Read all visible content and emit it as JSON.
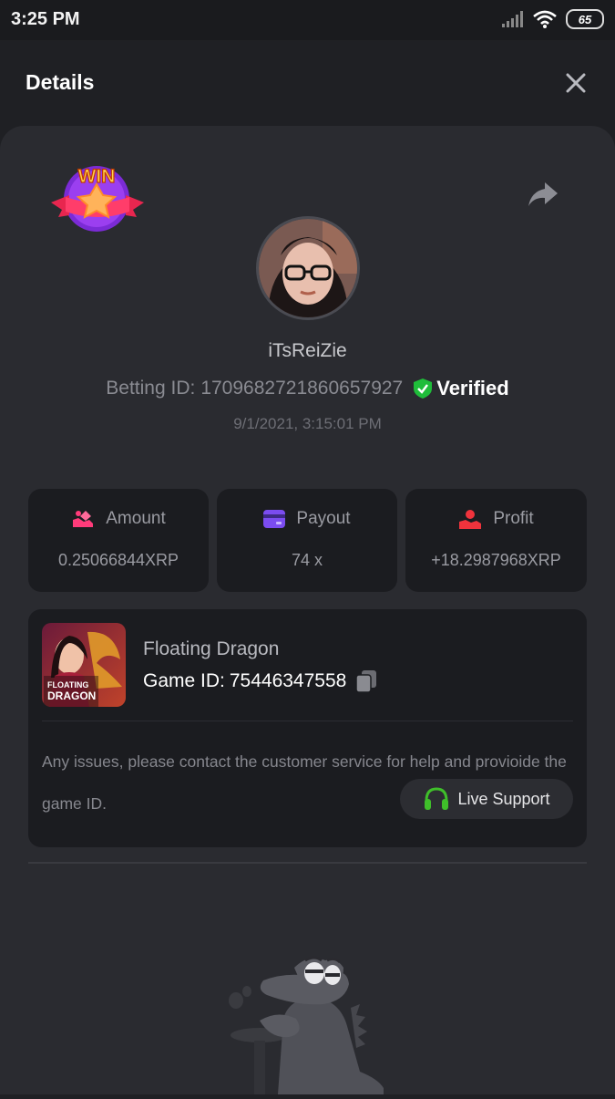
{
  "status_bar": {
    "time": "3:25 PM",
    "battery": "65",
    "icons": [
      "signal-icon",
      "wifi-icon",
      "battery-icon"
    ]
  },
  "header": {
    "title": "Details",
    "close_icon": "close-icon"
  },
  "bet": {
    "badge_text": "WIN",
    "username": "iTsReiZie",
    "betting_id_label": "Betting ID:",
    "betting_id": "1709682721860657927",
    "verified_label": "Verified",
    "timestamp": "9/1/2021, 3:15:01 PM"
  },
  "stats": [
    {
      "label": "Amount",
      "value": "0.25066844XRP",
      "icon": "amount-icon"
    },
    {
      "label": "Payout",
      "value": "74 x",
      "icon": "payout-card-icon"
    },
    {
      "label": "Profit",
      "value": "+18.2987968XRP",
      "icon": "profit-hand-icon"
    }
  ],
  "game": {
    "name": "Floating Dragon",
    "id_label": "Game ID:",
    "id": "75446347558",
    "thumb_text_top": "FLOATING",
    "thumb_text_bottom": "DRAGON",
    "notice": "Any issues, please contact the customer service for help and provioide the game ID.",
    "support_label": "Live Support"
  },
  "colors": {
    "background": "#1f2024",
    "panel": "#2a2b30",
    "card": "#1b1c20",
    "verified_green": "#1fbd3a",
    "payout_purple": "#7b4cf0",
    "amount_pink": "#ff3b7a",
    "profit_red": "#f0333c",
    "support_green": "#3fbf2a"
  }
}
